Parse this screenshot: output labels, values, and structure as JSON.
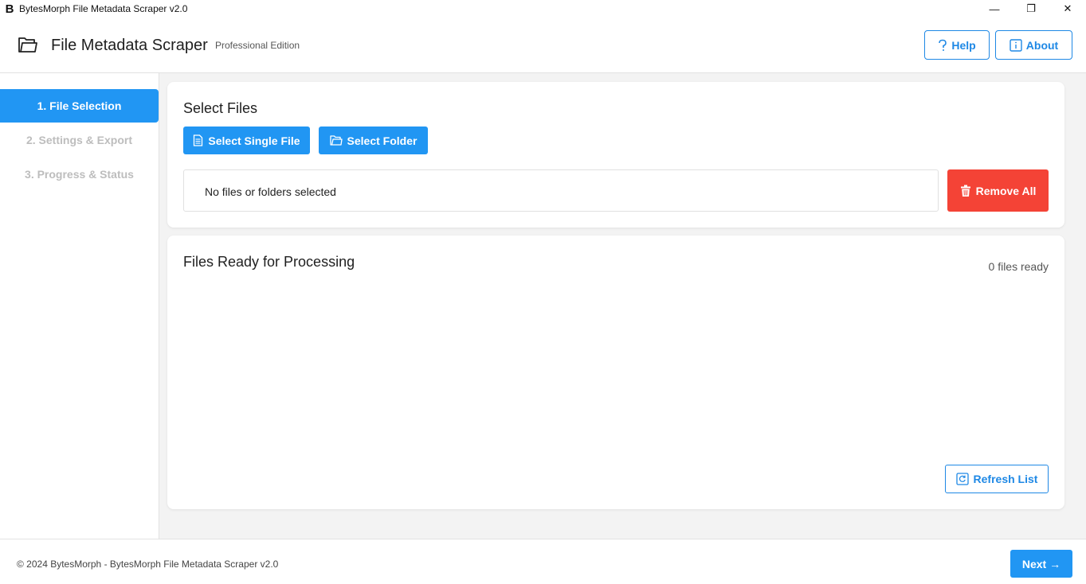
{
  "window": {
    "logo_letter": "B",
    "title": "BytesMorph File Metadata Scraper v2.0",
    "minimize_glyph": "—",
    "maximize_glyph": "❐",
    "close_glyph": "✕"
  },
  "header": {
    "icon": "folder-icon",
    "title": "File Metadata Scraper",
    "edition": "Professional Edition",
    "help_label": "Help",
    "about_label": "About"
  },
  "sidebar": {
    "items": [
      {
        "label": "1. File Selection",
        "active": true
      },
      {
        "label": "2. Settings & Export",
        "active": false
      },
      {
        "label": "3. Progress & Status",
        "active": false
      }
    ]
  },
  "select_files": {
    "title": "Select Files",
    "single_file_label": "Select Single File",
    "folder_label": "Select Folder",
    "selection_text": "No files or folders selected",
    "remove_all_label": "Remove All"
  },
  "files_ready": {
    "title": "Files Ready for Processing",
    "count_text": "0 files ready",
    "refresh_label": "Refresh List"
  },
  "footer": {
    "copyright": "© 2024 BytesMorph - BytesMorph File Metadata Scraper v2.0",
    "next_label": "Next →"
  },
  "colors": {
    "primary": "#2196f3",
    "danger": "#f44336",
    "background": "#f3f3f3"
  }
}
